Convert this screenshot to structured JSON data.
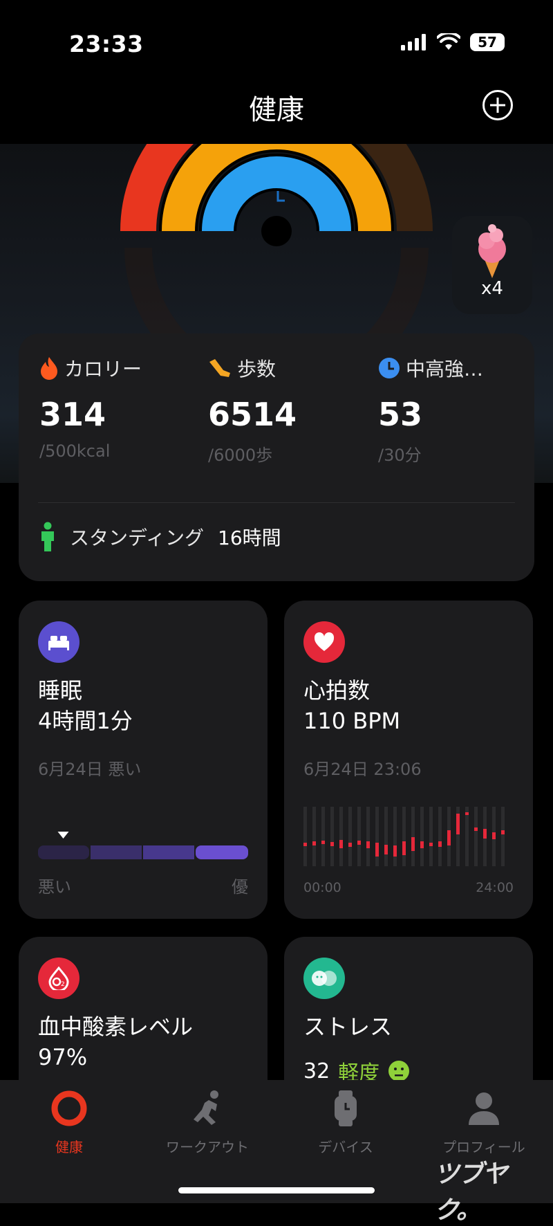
{
  "status": {
    "time": "23:33",
    "battery": "57"
  },
  "nav": {
    "title": "健康"
  },
  "reward": {
    "count": "x4"
  },
  "activity": {
    "calories": {
      "label": "カロリー",
      "value": "314",
      "goal": "/500kcal"
    },
    "steps": {
      "label": "歩数",
      "value": "6514",
      "goal": "/6000歩"
    },
    "intensity": {
      "label": "中高強…",
      "value": "53",
      "goal": "/30分"
    },
    "standing": {
      "label": "スタンディング",
      "value": "16時間"
    }
  },
  "sleep": {
    "title": "睡眠",
    "value": "4時間1分",
    "date": "6月24日 悪い",
    "scale_low": "悪い",
    "scale_high": "優",
    "quality_fraction": 0.12
  },
  "heart": {
    "title": "心拍数",
    "value": "110 BPM",
    "date": "6月24日 23:06",
    "x_start": "00:00",
    "x_end": "24:00"
  },
  "oxygen": {
    "title": "血中酸素レベル",
    "value": "97%"
  },
  "stress": {
    "title": "ストレス",
    "value": "32",
    "level": "軽度"
  },
  "tabs": [
    {
      "label": "健康"
    },
    {
      "label": "ワークアウト"
    },
    {
      "label": "デバイス"
    },
    {
      "label": "プロフィール"
    }
  ],
  "watermark": "ツブヤク。",
  "colors": {
    "accent": "#e8361f",
    "calories": "#ff5a1f",
    "steps": "#f5a623",
    "intensity": "#3b8ef0",
    "standing": "#34c759",
    "sleep": "#5b4fcf",
    "heart": "#e5283a",
    "stress": "#23b890",
    "stress_level": "#8fd13a"
  }
}
